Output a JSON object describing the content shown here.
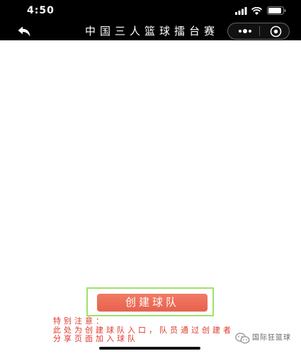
{
  "status_bar": {
    "time": "4:50",
    "icons": [
      "signal-icon",
      "wifi-icon",
      "battery-icon"
    ]
  },
  "nav_bar": {
    "back_icon": "back-icon",
    "title": "中国三人篮球擂台赛",
    "capsule_icons": [
      "more-icon",
      "target-icon"
    ]
  },
  "main": {
    "create_team_button": "创建球队",
    "notice": {
      "heading": "特别注意：",
      "lines": [
        "此处为创建球队入口，队员通过创建者",
        "分享页面加入球队"
      ]
    }
  },
  "watermark": {
    "icon": "wechat-icon",
    "text": "国际狂篮球"
  },
  "colors": {
    "nav_background": "#000000",
    "button_background": "#e8614d",
    "notice_text": "#e2382c",
    "highlight_border": "#9de26a",
    "watermark_text": "#666666"
  }
}
